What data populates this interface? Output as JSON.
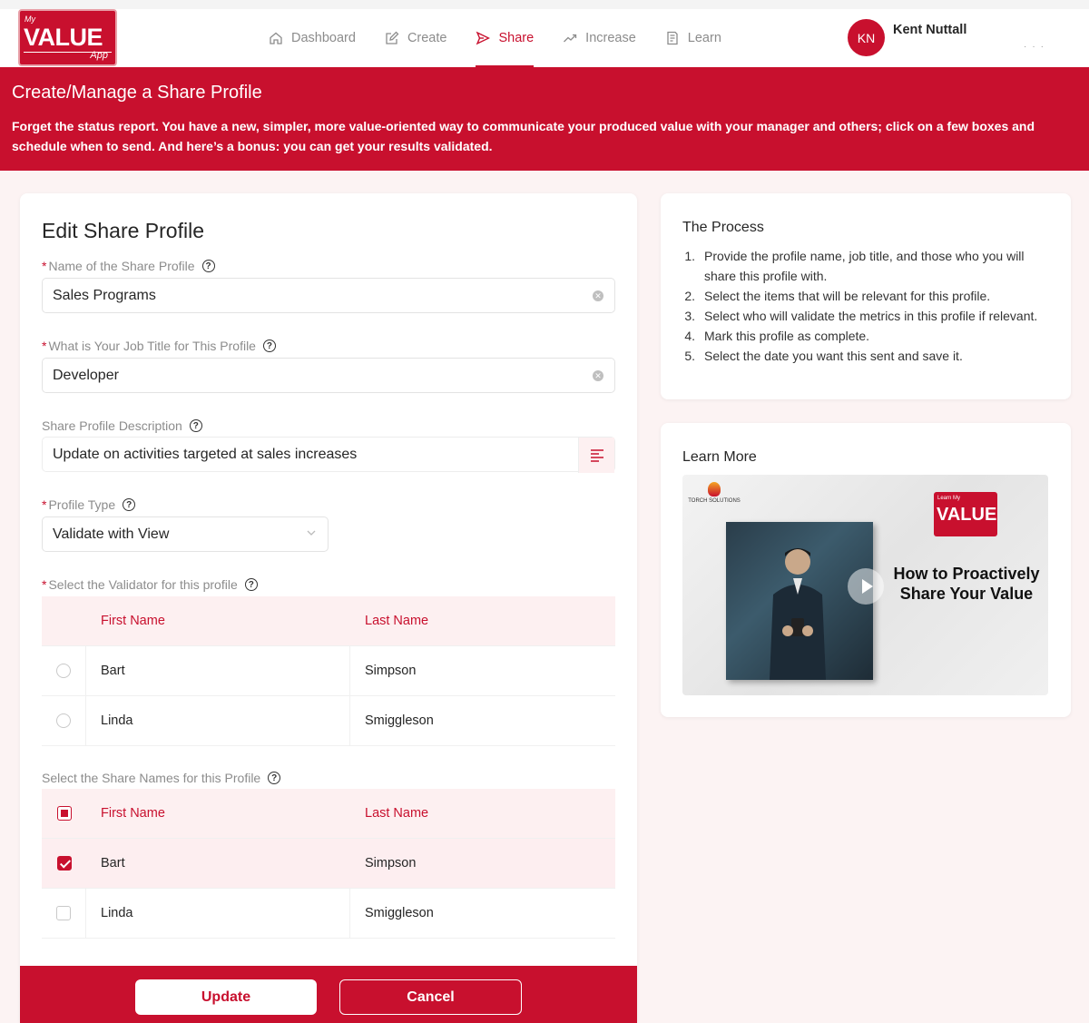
{
  "logo": {
    "my": "My",
    "value": "VALUE",
    "app": "App"
  },
  "nav": [
    {
      "label": "Dashboard",
      "icon": "home-icon"
    },
    {
      "label": "Create",
      "icon": "edit-icon"
    },
    {
      "label": "Share",
      "icon": "send-icon",
      "active": true
    },
    {
      "label": "Increase",
      "icon": "trend-up-icon"
    },
    {
      "label": "Learn",
      "icon": "book-icon"
    }
  ],
  "user": {
    "initials": "KN",
    "name": "Kent Nuttall"
  },
  "banner": {
    "title": "Create/Manage a Share Profile",
    "text": "Forget the status report. You have a new, simpler, more value-oriented way to communicate your produced value with your manager and others; click on a few boxes and schedule when to send. And here’s a bonus: you can get your results validated."
  },
  "form": {
    "title": "Edit Share Profile",
    "name_label": "Name of the Share Profile",
    "name_value": "Sales Programs",
    "job_label": "What is Your Job Title for This Profile",
    "job_value": "Developer",
    "desc_label": "Share Profile Description",
    "desc_value": "Update on activities targeted at sales increases",
    "type_label": "Profile Type",
    "type_value": "Validate with View",
    "validator_label": "Select the Validator for this profile",
    "share_label": "Select the Share Names for this Profile",
    "col_first": "First Name",
    "col_last": "Last Name",
    "validators": [
      {
        "first": "Bart",
        "last": "Simpson"
      },
      {
        "first": "Linda",
        "last": "Smiggleson"
      }
    ],
    "share_names": [
      {
        "first": "Bart",
        "last": "Simpson",
        "checked": true
      },
      {
        "first": "Linda",
        "last": "Smiggleson",
        "checked": false
      }
    ],
    "update_label": "Update",
    "cancel_label": "Cancel"
  },
  "process": {
    "title": "The Process",
    "steps": [
      "Provide the profile name, job title, and those who you will share this profile with.",
      "Select the items that will be relevant for this profile.",
      "Select who will validate the metrics in this profile if relevant.",
      "Mark this profile as complete.",
      "Select the date you want this sent and save it."
    ]
  },
  "learn": {
    "title": "Learn More",
    "video_title": "How to Proactively Share Your Value",
    "video_logo_small": "Learn My",
    "video_logo_big": "VALUE",
    "video_brand": "TORCH SOLUTIONS"
  },
  "colors": {
    "brand": "#c8102e"
  }
}
